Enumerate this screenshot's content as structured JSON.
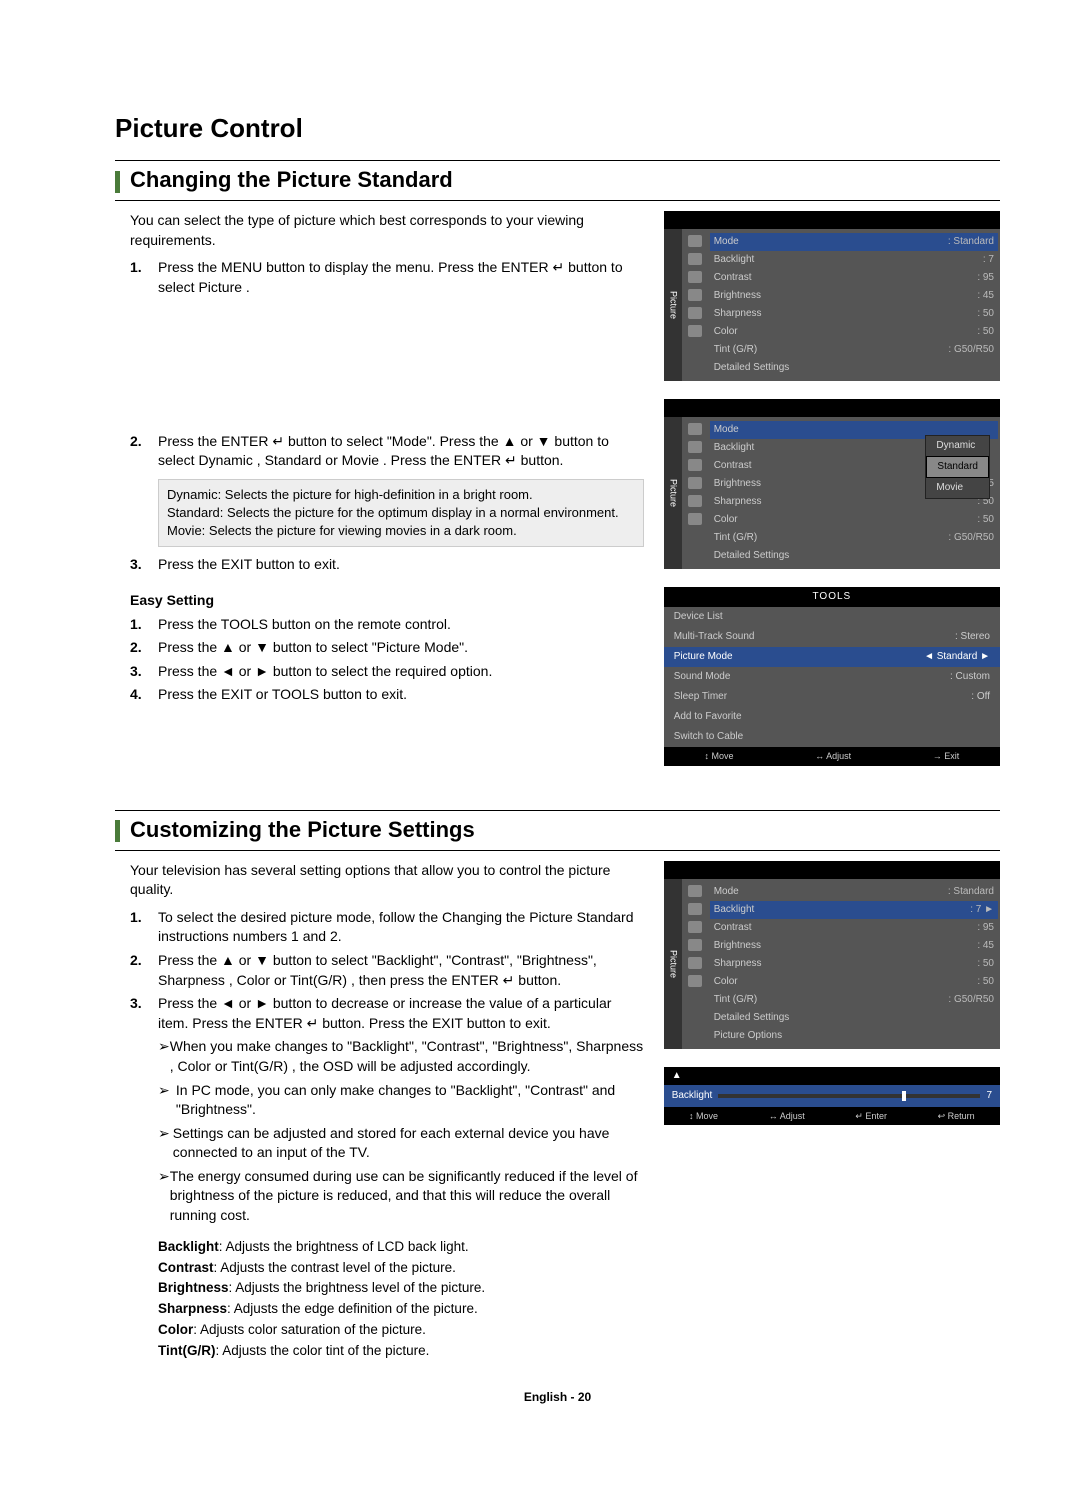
{
  "title": "Picture Control",
  "section1": {
    "heading": "Changing the Picture Standard",
    "intro": "You can select the type of picture which best corresponds to your viewing requirements.",
    "steps": [
      {
        "n": "1.",
        "text": "Press the MENU button to display the menu.\nPress the ENTER ↵ button to select  Picture ."
      },
      {
        "n": "2.",
        "text": "Press the ENTER ↵ button to select \"Mode\". Press the ▲ or ▼ button to select  Dynamic ,  Standard  or  Movie . Press the  ENTER ↵ button."
      },
      {
        "n": "3.",
        "text": "Press the EXIT button to exit."
      }
    ],
    "infobox": [
      "Dynamic: Selects the picture for high-definition in a bright room.",
      "Standard: Selects the picture for the optimum display in a normal environment.",
      "Movie: Selects the picture for viewing movies in a dark room."
    ],
    "easy_head": "Easy Setting",
    "easy_steps": [
      {
        "n": "1.",
        "text": "Press the TOOLS button on the remote control."
      },
      {
        "n": "2.",
        "text": "Press the ▲ or ▼ button to select \"Picture Mode\"."
      },
      {
        "n": "3.",
        "text": "Press the ◄ or ► button to select the required option."
      },
      {
        "n": "4.",
        "text": "Press the EXIT or TOOLS button to exit."
      }
    ]
  },
  "section2": {
    "heading": "Customizing the Picture Settings",
    "intro": "Your television has several setting options that allow you to control the picture quality.",
    "steps": [
      {
        "n": "1.",
        "text": "To select the desired picture mode, follow the  Changing the Picture Standard  instructions numbers 1 and 2."
      },
      {
        "n": "2.",
        "text": "Press the ▲ or ▼ button to select \"Backlight\", \"Contrast\", \"Brightness\",  Sharpness ,  Color  or  Tint(G/R) , then press the  ENTER ↵ button."
      },
      {
        "n": "3.",
        "text": "Press the ◄ or ► button to decrease or increase the value of a particular item. Press the ENTER ↵ button.\nPress the EXIT button to exit."
      }
    ],
    "arrows": [
      "When you make changes to \"Backlight\", \"Contrast\", \"Brightness\",  Sharpness ,  Color  or  Tint(G/R) , the OSD will be adjusted accordingly.",
      "In PC mode, you can only make changes to \"Backlight\", \"Contrast\" and \"Brightness\".",
      "Settings can be adjusted and stored for each external device you have connected to an input of the TV.",
      "The energy consumed during use can be significantly reduced if the level of brightness of the picture is reduced, and that this will reduce the overall running cost."
    ],
    "defs": [
      {
        "k": "Backlight",
        "v": ": Adjusts the brightness of LCD back light."
      },
      {
        "k": "Contrast",
        "v": ": Adjusts the contrast level of the picture."
      },
      {
        "k": "Brightness",
        "v": ": Adjusts the brightness level of the picture."
      },
      {
        "k": "Sharpness",
        "v": ": Adjusts the edge definition of the picture."
      },
      {
        "k": "Color",
        "v": ": Adjusts color saturation of the picture."
      },
      {
        "k": "Tint(G/R)",
        "v": ": Adjusts the color tint of the picture."
      }
    ]
  },
  "footer": "English - 20",
  "osd1": {
    "vtab": "Picture",
    "rows": [
      {
        "lab": "Mode",
        "val": ": Standard",
        "hl": true
      },
      {
        "lab": "Backlight",
        "val": ": 7"
      },
      {
        "lab": "Contrast",
        "val": ": 95"
      },
      {
        "lab": "Brightness",
        "val": ": 45"
      },
      {
        "lab": "Sharpness",
        "val": ": 50"
      },
      {
        "lab": "Color",
        "val": ": 50"
      },
      {
        "lab": "Tint (G/R)",
        "val": ": G50/R50"
      },
      {
        "lab": "Detailed Settings",
        "val": ""
      }
    ]
  },
  "osd2": {
    "vtab": "Picture",
    "rows": [
      {
        "lab": "Mode",
        "val": "",
        "hl": true
      },
      {
        "lab": "Backlight",
        "val": ""
      },
      {
        "lab": "Contrast",
        "val": ""
      },
      {
        "lab": "Brightness",
        "val": ": 45"
      },
      {
        "lab": "Sharpness",
        "val": ": 50"
      },
      {
        "lab": "Color",
        "val": ": 50"
      },
      {
        "lab": "Tint (G/R)",
        "val": ": G50/R50"
      },
      {
        "lab": "Detailed Settings",
        "val": ""
      }
    ],
    "drop": [
      "Dynamic",
      "Standard",
      "Movie"
    ],
    "drop_sel": 1
  },
  "tools": {
    "title": "TOOLS",
    "rows": [
      {
        "l": "Device List",
        "r": ""
      },
      {
        "l": "Multi-Track Sound",
        "r": ": Stereo"
      },
      {
        "l": "Picture Mode",
        "r": "◄   Standard   ►",
        "hl": true
      },
      {
        "l": "Sound Mode",
        "r": ": Custom"
      },
      {
        "l": "Sleep Timer",
        "r": ": Off"
      },
      {
        "l": "Add to Favorite",
        "r": ""
      },
      {
        "l": "Switch to Cable",
        "r": ""
      }
    ],
    "foot": [
      "↕ Move",
      "↔ Adjust",
      "→ Exit"
    ]
  },
  "osd3": {
    "vtab": "Picture",
    "rows": [
      {
        "lab": "Mode",
        "val": ": Standard"
      },
      {
        "lab": "Backlight",
        "val": ": 7",
        "hl": true,
        "tail": "►"
      },
      {
        "lab": "Contrast",
        "val": ": 95"
      },
      {
        "lab": "Brightness",
        "val": ": 45"
      },
      {
        "lab": "Sharpness",
        "val": ": 50"
      },
      {
        "lab": "Color",
        "val": ": 50"
      },
      {
        "lab": "Tint (G/R)",
        "val": ": G50/R50"
      },
      {
        "lab": "Detailed Settings",
        "val": ""
      },
      {
        "lab": "Picture Options",
        "val": ""
      }
    ]
  },
  "slider": {
    "label": "Backlight",
    "value": "7",
    "pos": 70,
    "uptri": "▲",
    "foot": [
      "↕ Move",
      "↔ Adjust",
      "↵ Enter",
      "↩ Return"
    ]
  }
}
